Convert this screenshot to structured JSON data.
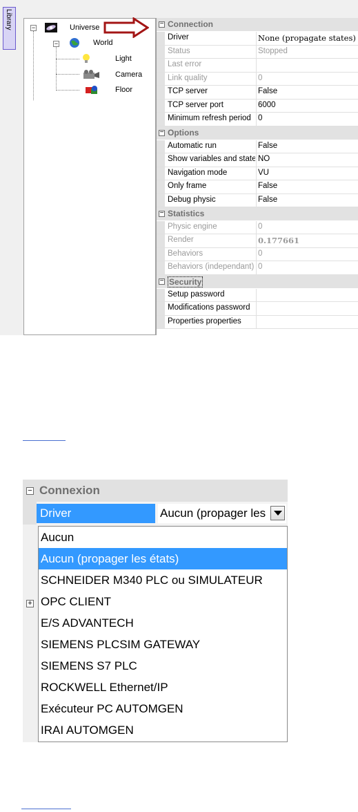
{
  "library_tab": {
    "label": "Library"
  },
  "tree": {
    "nodes": [
      {
        "label": "Universe",
        "icon": "galaxy-icon",
        "expander": "−"
      },
      {
        "label": "World",
        "icon": "globe-icon",
        "expander": "−"
      },
      {
        "label": "Light",
        "icon": "light-bulb-icon"
      },
      {
        "label": "Camera",
        "icon": "camera-icon"
      },
      {
        "label": "Floor",
        "icon": "floor-shapes-icon"
      }
    ]
  },
  "grid": {
    "categories": [
      {
        "label": "Connection",
        "rows": [
          {
            "name": "Driver",
            "value": "None (propagate states)"
          },
          {
            "name": "Status",
            "value": "Stopped"
          },
          {
            "name": "Last error",
            "value": ""
          },
          {
            "name": "Link quality",
            "value": "0"
          },
          {
            "name": "TCP server",
            "value": "False"
          },
          {
            "name": "TCP server port",
            "value": "6000"
          },
          {
            "name": "Minimum refresh period",
            "value": "0"
          }
        ]
      },
      {
        "label": "Options",
        "rows": [
          {
            "name": "Automatic run",
            "value": "False"
          },
          {
            "name": "Show variables and states",
            "value": "NO"
          },
          {
            "name": "Navigation mode",
            "value": "VU"
          },
          {
            "name": "Only frame",
            "value": "False"
          },
          {
            "name": "Debug physic",
            "value": "False"
          }
        ]
      },
      {
        "label": "Statistics",
        "rows": [
          {
            "name": "Physic engine",
            "value": "0"
          },
          {
            "name": "Render",
            "value": "0.177661"
          },
          {
            "name": "Behaviors",
            "value": "0"
          },
          {
            "name": "Behaviors (independant)",
            "value": "0"
          }
        ]
      },
      {
        "label": "Security",
        "rows": [
          {
            "name": "Setup password",
            "value": ""
          },
          {
            "name": "Modifications password",
            "value": ""
          },
          {
            "name": "Properties properties",
            "value": ""
          }
        ]
      }
    ]
  },
  "connexion": {
    "category": "Connexion",
    "field_label": "Driver",
    "selected_value": "Aucun (propager les états)",
    "options": [
      "Aucun",
      "Aucun (propager les états)",
      "SCHNEIDER M340 PLC ou SIMULATEUR",
      "OPC CLIENT",
      "E/S ADVANTECH",
      "SIEMENS PLCSIM GATEWAY",
      "SIEMENS S7 PLC",
      "ROCKWELL Ethernet/IP",
      "Exécuteur PC AUTOMGEN",
      "IRAI AUTOMGEN"
    ],
    "selected_index": 1
  },
  "colors": {
    "accent": "#3399ff",
    "arrow": "#a31515"
  }
}
